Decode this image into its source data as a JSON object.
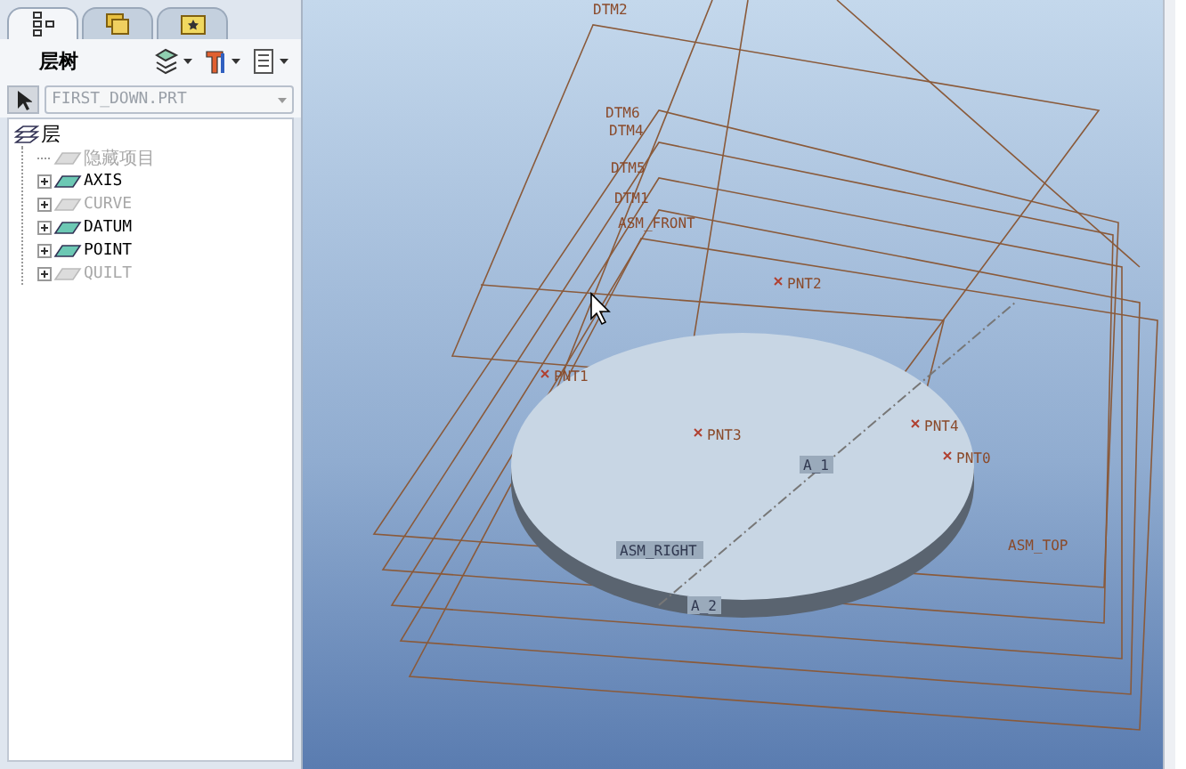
{
  "navigator": {
    "tabs": [
      {
        "kind": "tree",
        "selected": true
      },
      {
        "kind": "folders",
        "selected": false
      },
      {
        "kind": "favorites",
        "selected": false
      }
    ],
    "title": "层树",
    "model": {
      "value": "FIRST_DOWN.PRT",
      "disabled": true
    },
    "tree": {
      "label": "层",
      "children": [
        {
          "label": "隐藏项目",
          "dimmed": true,
          "expandable": false
        },
        {
          "label": "AXIS",
          "dimmed": false,
          "expandable": true
        },
        {
          "label": "CURVE",
          "dimmed": true,
          "expandable": true
        },
        {
          "label": "DATUM",
          "dimmed": false,
          "expandable": true
        },
        {
          "label": "POINT",
          "dimmed": false,
          "expandable": true
        },
        {
          "label": "QUILT",
          "dimmed": true,
          "expandable": true
        }
      ]
    }
  },
  "graphics": {
    "labels": [
      {
        "kind": "datum",
        "text": "DTM2"
      },
      {
        "kind": "datum",
        "text": "DTM6"
      },
      {
        "kind": "datum",
        "text": "DTM4"
      },
      {
        "kind": "datum",
        "text": "DTM5"
      },
      {
        "kind": "datum",
        "text": "DTM1"
      },
      {
        "kind": "datum",
        "text": "ASM_FRONT"
      },
      {
        "kind": "point",
        "text": "PNT2"
      },
      {
        "kind": "point",
        "text": "PNT1"
      },
      {
        "kind": "point",
        "text": "PNT3"
      },
      {
        "kind": "point",
        "text": "PNT4"
      },
      {
        "kind": "point",
        "text": "PNT0"
      },
      {
        "kind": "axis",
        "text": "A_1"
      },
      {
        "kind": "axis",
        "text": "ASM_RIGHT"
      },
      {
        "kind": "axis",
        "text": "A_2"
      },
      {
        "kind": "datum",
        "text": "ASM_TOP"
      }
    ]
  }
}
